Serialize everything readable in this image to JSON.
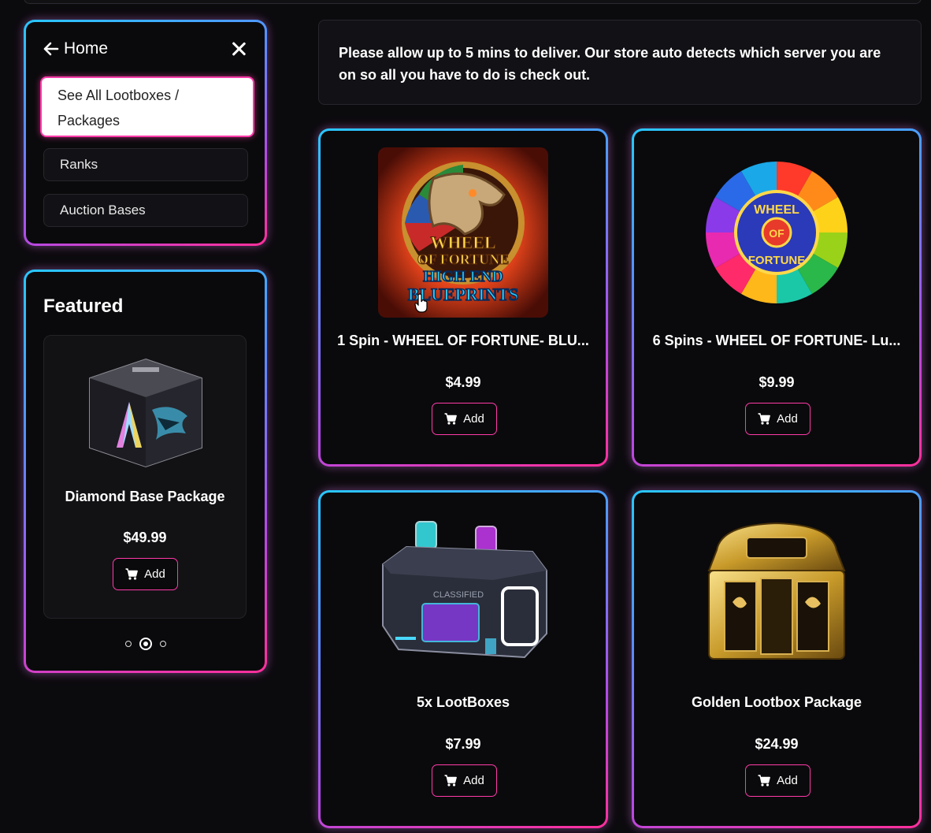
{
  "nav": {
    "home_label": "Home",
    "items": [
      {
        "label": "See All Lootboxes / Packages",
        "active": true
      },
      {
        "label": "Ranks",
        "active": false
      },
      {
        "label": "Auction Bases",
        "active": false
      }
    ]
  },
  "featured": {
    "title": "Featured",
    "product": {
      "name": "Diamond Base Package",
      "price": "$49.99",
      "add_label": "Add"
    },
    "carousel": {
      "count": 3,
      "active_index": 1
    }
  },
  "notice": {
    "text": "Please allow up to 5 mins to deliver. Our store auto detects which server you are on so all you have to do is check out."
  },
  "products": [
    {
      "name": "1 Spin - WHEEL OF FORTUNE- BLU...",
      "price": "$4.99",
      "add_label": "Add",
      "image_text": [
        "WHEEL",
        "OF FORTUNE",
        "HIGH END",
        "BLUEPRINTS"
      ]
    },
    {
      "name": "6 Spins - WHEEL OF FORTUNE- Lu...",
      "price": "$9.99",
      "add_label": "Add",
      "image_text": [
        "WHEEL",
        "OF",
        "FORTUNE"
      ]
    },
    {
      "name": "5x LootBoxes",
      "price": "$7.99",
      "add_label": "Add",
      "image_text": [
        "CLASSIFIED"
      ]
    },
    {
      "name": "Golden Lootbox Package",
      "price": "$24.99",
      "add_label": "Add"
    }
  ],
  "colors": {
    "background": "#0b0b0e",
    "accent_pink": "#ff3aa8",
    "accent_cyan": "#28c8ff",
    "card_bg": "#0a0a0c"
  }
}
